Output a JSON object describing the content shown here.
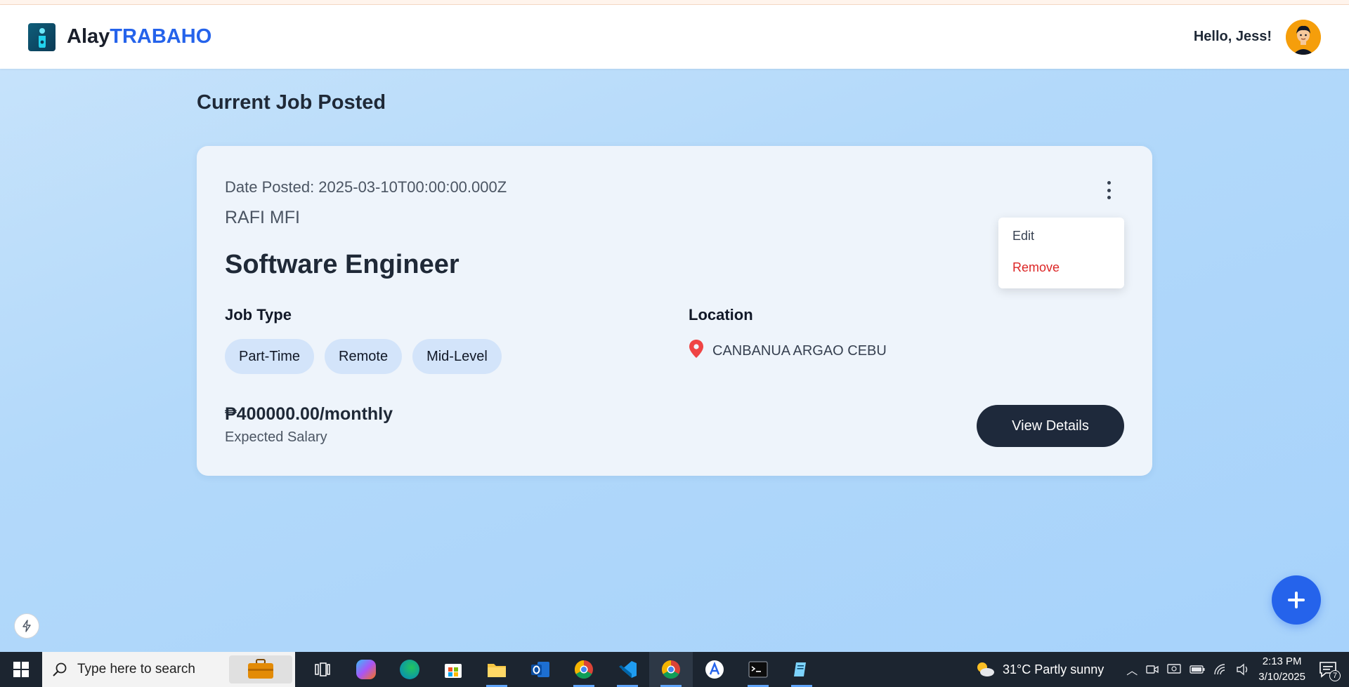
{
  "app": {
    "brand_part1": "Alay",
    "brand_part2": "TRABAHO",
    "greeting": "Hello, Jess!"
  },
  "page": {
    "title": "Current Job Posted"
  },
  "job": {
    "date_posted": "Date Posted: 2025-03-10T00:00:00.000Z",
    "company": "RAFI MFI",
    "title": "Software Engineer",
    "job_type_label": "Job Type",
    "tags": [
      "Part-Time",
      "Remote",
      "Mid-Level"
    ],
    "location_label": "Location",
    "location": "CANBANUA ARGAO CEBU",
    "salary": "₱400000.00/monthly",
    "salary_label": "Expected Salary",
    "view_button": "View Details"
  },
  "menu": {
    "edit": "Edit",
    "remove": "Remove"
  },
  "taskbar": {
    "search_placeholder": "Type here to search",
    "weather": "31°C  Partly sunny",
    "time": "2:13 PM",
    "date": "3/10/2025",
    "notification_count": "7"
  },
  "colors": {
    "brand_blue": "#2563eb",
    "dark_button": "#1e293b",
    "danger": "#dc2626",
    "tag_bg": "#d3e4fa"
  }
}
